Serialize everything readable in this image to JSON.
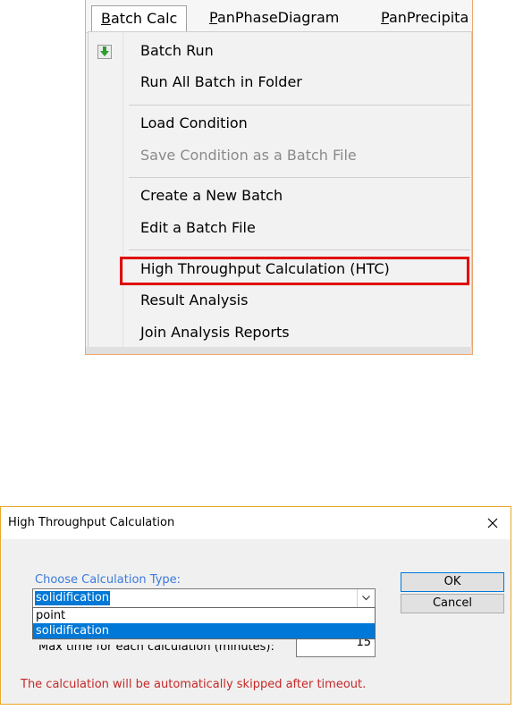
{
  "menubar": {
    "items": [
      {
        "label": "Batch Calc",
        "mnemonic": "B",
        "rest": "atch Calc"
      },
      {
        "label": "PanPhaseDiagram",
        "mnemonic": "P",
        "rest": "anPhaseDiagram"
      },
      {
        "label": "PanPrecipita",
        "mnemonic": "P",
        "rest": "anPrecipita"
      }
    ]
  },
  "menu": {
    "items": [
      {
        "label": "Batch Run",
        "icon": "batch-run-down-arrow-icon",
        "enabled": true
      },
      {
        "label": "Run All Batch in Folder",
        "enabled": true
      },
      {
        "label": "Load Condition",
        "enabled": true
      },
      {
        "label": "Save Condition as a Batch File",
        "enabled": false
      },
      {
        "label": "Create a New Batch",
        "enabled": true
      },
      {
        "label": "Edit a Batch File",
        "enabled": true
      },
      {
        "label": "High Throughput Calculation (HTC)",
        "enabled": true,
        "highlighted": true
      },
      {
        "label": "Result Analysis",
        "enabled": true
      },
      {
        "label": "Join Analysis Reports",
        "enabled": true
      }
    ],
    "highlight_color": "#e00000"
  },
  "dialog": {
    "title": "High Throughput Calculation",
    "calc_type_label": "Choose Calculation Type:",
    "calc_type_value": "solidification",
    "options": [
      "point",
      "solidification"
    ],
    "selected_option": "solidification",
    "max_time_label": "Max time for each calculation (minutes):",
    "max_time_value": "15",
    "timeout_note": "The calculation will be automatically skipped after timeout.",
    "ok_label": "OK",
    "cancel_label": "Cancel"
  },
  "colors": {
    "accent": "#0078d7",
    "label_blue": "#3b7bdc",
    "warning_red": "#c62828",
    "dialog_border": "#e8a72a"
  }
}
